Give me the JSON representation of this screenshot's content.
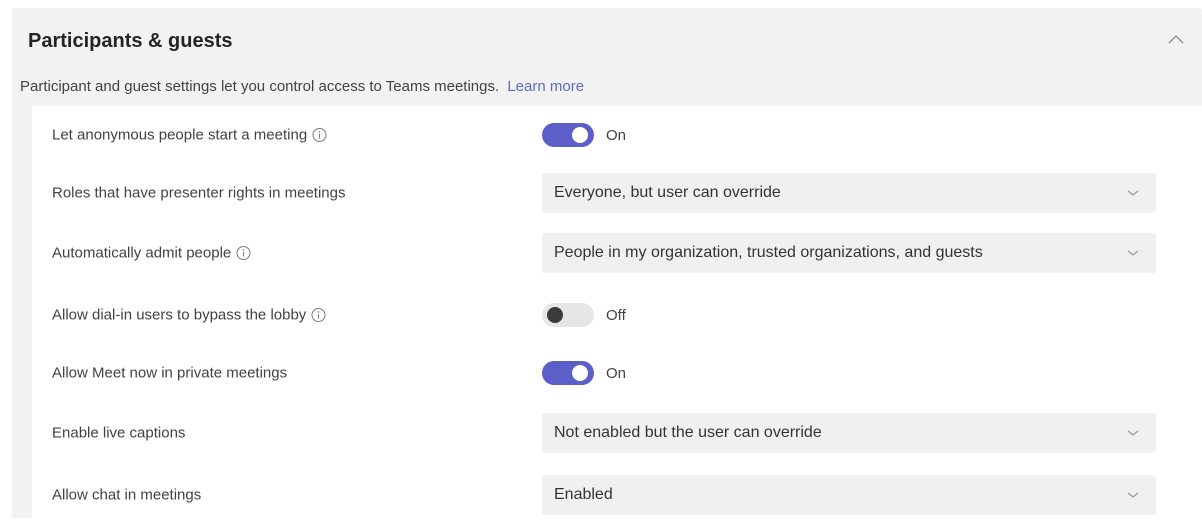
{
  "section": {
    "title": "Participants & guests",
    "description": "Participant and guest settings let you control access to Teams meetings.",
    "learn_more": "Learn more"
  },
  "settings": [
    {
      "label": "Let anonymous people start a meeting",
      "info": true,
      "control": "toggle",
      "state": "on",
      "value": "On"
    },
    {
      "label": "Roles that have presenter rights in meetings",
      "info": false,
      "control": "select",
      "value": "Everyone, but user can override"
    },
    {
      "label": "Automatically admit people",
      "info": true,
      "control": "select",
      "value": "People in my organization, trusted organizations, and guests"
    },
    {
      "label": "Allow dial-in users to bypass the lobby",
      "info": true,
      "control": "toggle",
      "state": "off",
      "value": "Off"
    },
    {
      "label": "Allow Meet now in private meetings",
      "info": false,
      "control": "toggle",
      "state": "on",
      "value": "On"
    },
    {
      "label": "Enable live captions",
      "info": false,
      "control": "select",
      "value": "Not enabled but the user can override"
    },
    {
      "label": "Allow chat in meetings",
      "info": false,
      "control": "select",
      "value": "Enabled"
    }
  ],
  "icons": {
    "collapse": "chevron-up-icon",
    "info": "info-icon",
    "dropdown": "chevron-down-icon"
  },
  "colors": {
    "toggle_on": "#5b5fc7",
    "toggle_off": "#e6e6e6",
    "link": "#5b6cc0"
  }
}
